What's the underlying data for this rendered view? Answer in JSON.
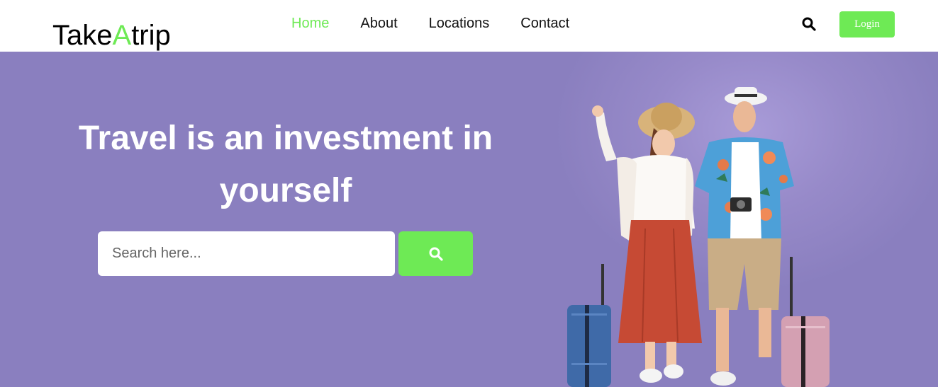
{
  "header": {
    "logo_prefix": "Take",
    "logo_accent": "A",
    "logo_suffix": "trip",
    "nav": [
      {
        "label": "Home",
        "active": true
      },
      {
        "label": "About",
        "active": false
      },
      {
        "label": "Locations",
        "active": false
      },
      {
        "label": "Contact",
        "active": false
      }
    ],
    "search_icon": "search-icon",
    "login_label": "Login"
  },
  "hero": {
    "headline_line1": "Travel is an investment in",
    "headline_line2": "yourself",
    "search_placeholder": "Search here...",
    "search_button_icon": "search-icon",
    "image": "travel-couple-with-suitcases"
  },
  "colors": {
    "accent": "#6eea55",
    "hero_background": "#8a7fbf",
    "text_dark": "#111111"
  }
}
